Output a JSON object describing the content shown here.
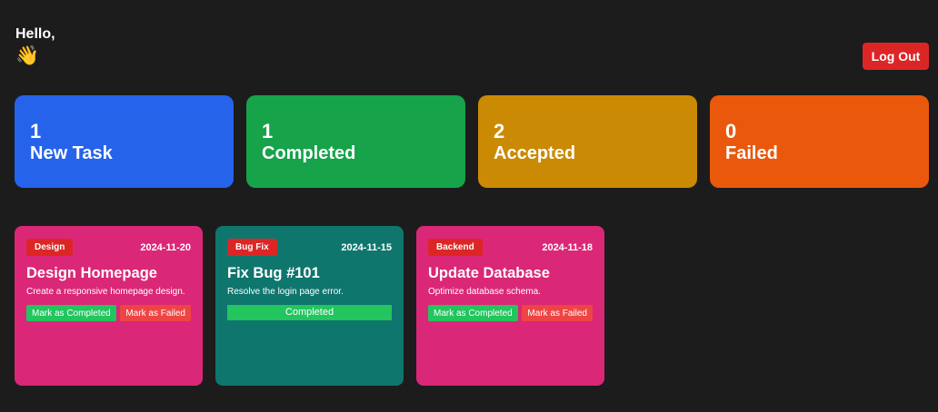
{
  "header": {
    "greeting": "Hello,",
    "wave": "👋",
    "logout_label": "Log Out"
  },
  "stats": [
    {
      "count": "1",
      "label": "New Task",
      "color": "#2563eb"
    },
    {
      "count": "1",
      "label": "Completed",
      "color": "#16a34a"
    },
    {
      "count": "2",
      "label": "Accepted",
      "color": "#ca8a04"
    },
    {
      "count": "0",
      "label": "Failed",
      "color": "#ea580c"
    }
  ],
  "tasks": [
    {
      "category": "Design",
      "date": "2024-11-20",
      "title": "Design Homepage",
      "description": "Create a responsive homepage design.",
      "complete_label": "Mark as Completed",
      "fail_label": "Mark as Failed",
      "color": "#db2777"
    },
    {
      "category": "Bug Fix",
      "date": "2024-11-15",
      "title": "Fix Bug #101",
      "description": "Resolve the login page error.",
      "status": "Completed",
      "color": "#0f766e"
    },
    {
      "category": "Backend",
      "date": "2024-11-18",
      "title": "Update Database",
      "description": "Optimize database schema.",
      "complete_label": "Mark as Completed",
      "fail_label": "Mark as Failed",
      "color": "#db2777"
    }
  ]
}
